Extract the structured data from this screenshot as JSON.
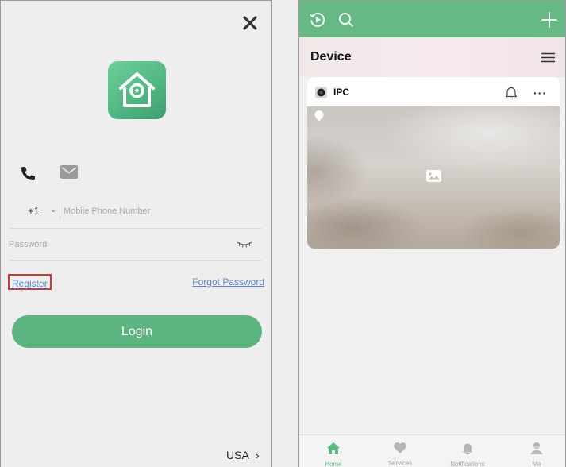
{
  "login_screen": {
    "close_icon": "close-icon",
    "logo_icon": "home-camera-logo",
    "method_icons": [
      "phone-icon",
      "mail-icon"
    ],
    "country_code": "+1",
    "phone_placeholder": "Mobile Phone Number",
    "password_placeholder": "Password",
    "register_label": "Register",
    "forgot_label": "Forgot Password",
    "login_label": "Login",
    "region_label": "USA",
    "region_chevron": "›",
    "accent_color": "#5cb580",
    "link_color": "#5b86c8",
    "highlight_color": "#c73a3a"
  },
  "device_screen": {
    "header_icons": [
      "play-history-icon",
      "search-icon",
      "add-icon"
    ],
    "title": "Device",
    "card": {
      "name": "IPC",
      "icons": [
        "camera-icon",
        "bell-icon",
        "more-icon",
        "pin-icon",
        "image-placeholder-icon"
      ],
      "more_glyph": "···"
    },
    "nav": [
      {
        "label": "Home",
        "icon": "home-icon",
        "active": true
      },
      {
        "label": "Services",
        "icon": "heart-icon",
        "active": false
      },
      {
        "label": "Notifications",
        "icon": "bell-icon",
        "active": false
      },
      {
        "label": "Me",
        "icon": "user-icon",
        "active": false
      }
    ],
    "header_color": "#66b985"
  }
}
